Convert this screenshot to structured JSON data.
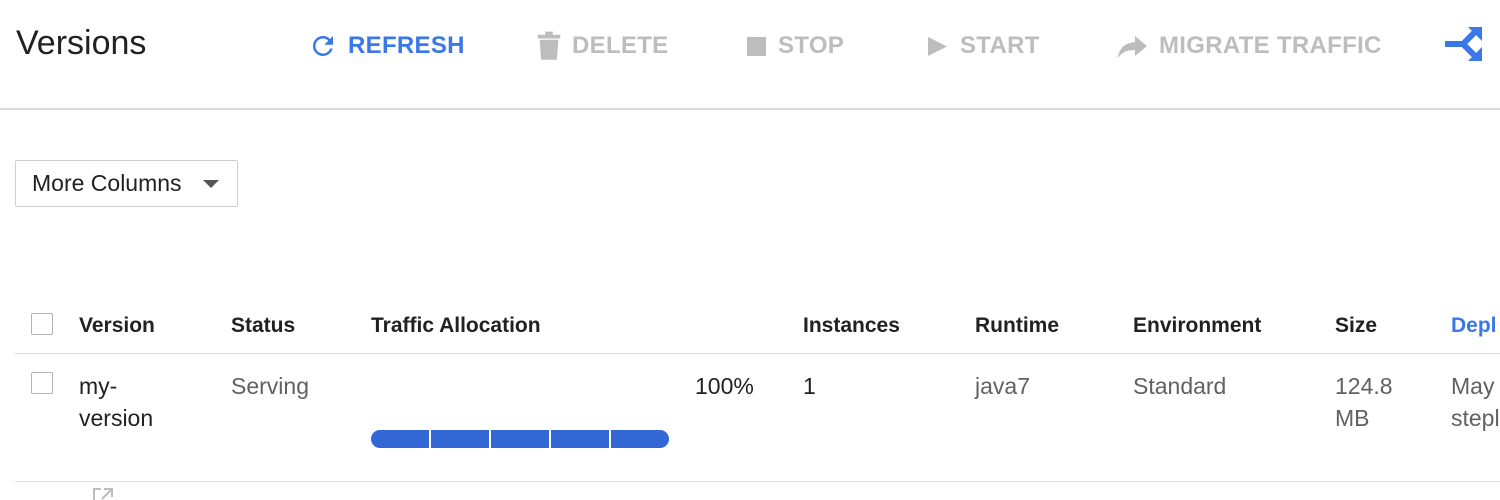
{
  "header": {
    "title": "Versions"
  },
  "toolbar": {
    "refresh": {
      "label": "REFRESH",
      "icon": "refresh-icon",
      "enabled": true
    },
    "delete": {
      "label": "DELETE",
      "icon": "trash-icon",
      "enabled": false
    },
    "stop": {
      "label": "STOP",
      "icon": "stop-icon",
      "enabled": false
    },
    "start": {
      "label": "START",
      "icon": "play-icon",
      "enabled": false
    },
    "migrate": {
      "label": "MIGRATE TRAFFIC",
      "icon": "forward-arrow-icon",
      "enabled": false
    },
    "split": {
      "label": "",
      "icon": "split-traffic-icon",
      "enabled": true
    }
  },
  "controls": {
    "more_columns": "More Columns"
  },
  "table": {
    "columns": [
      "Version",
      "Status",
      "Traffic Allocation",
      "Instances",
      "Runtime",
      "Environment",
      "Size",
      "Depl"
    ],
    "rows": [
      {
        "version_line1": "my-",
        "version_line2": "version",
        "status": "Serving",
        "traffic_percent": "100%",
        "traffic_fraction": 1.0,
        "instances": "1",
        "runtime": "java7",
        "environment": "Standard",
        "size_line1": "124.8",
        "size_line2": "MB",
        "deployed_line1": "May",
        "deployed_line2": "stepl"
      }
    ]
  },
  "colors": {
    "accent": "#3b78e7",
    "disabled": "#bdbdbd",
    "traffic_bar": "#3367d6"
  }
}
